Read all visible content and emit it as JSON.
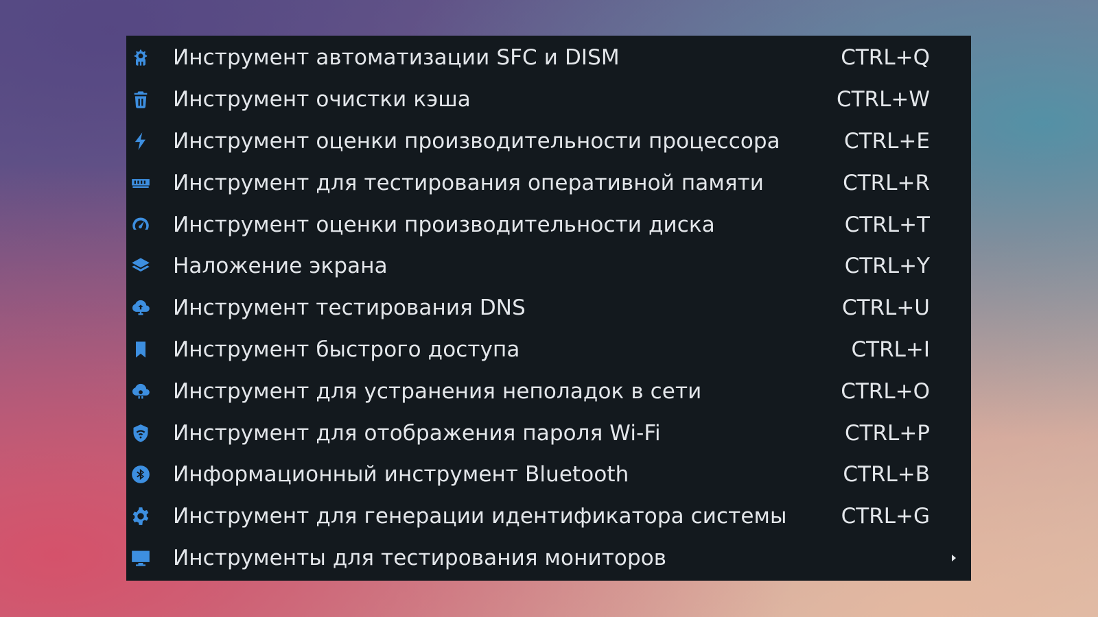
{
  "menu": {
    "items": [
      {
        "label": "Инструмент автоматизации SFC и DISM",
        "shortcut": "CTRL+Q",
        "icon": "tools-gear-icon"
      },
      {
        "label": "Инструмент очистки кэша",
        "shortcut": "CTRL+W",
        "icon": "trash-icon"
      },
      {
        "label": "Инструмент оценки производительности процессора",
        "shortcut": "CTRL+E",
        "icon": "lightning-icon"
      },
      {
        "label": "Инструмент для тестирования оперативной памяти",
        "shortcut": "CTRL+R",
        "icon": "memory-icon"
      },
      {
        "label": "Инструмент оценки производительности диска",
        "shortcut": "CTRL+T",
        "icon": "gauge-icon"
      },
      {
        "label": "Наложение экрана",
        "shortcut": "CTRL+Y",
        "icon": "layers-icon"
      },
      {
        "label": "Инструмент тестирования DNS",
        "shortcut": "CTRL+U",
        "icon": "cloud-network-icon"
      },
      {
        "label": "Инструмент быстрого доступа",
        "shortcut": "CTRL+I",
        "icon": "bookmark-icon"
      },
      {
        "label": "Инструмент для устранения неполадок в сети",
        "shortcut": "CTRL+O",
        "icon": "cloud-gear-icon"
      },
      {
        "label": "Инструмент для отображения пароля Wi-Fi",
        "shortcut": "CTRL+P",
        "icon": "wifi-shield-icon"
      },
      {
        "label": "Информационный инструмент Bluetooth",
        "shortcut": "CTRL+B",
        "icon": "bluetooth-icon"
      },
      {
        "label": "Инструмент для генерации идентификатора системы",
        "shortcut": "CTRL+G",
        "icon": "gear-icon"
      },
      {
        "label": "Инструменты для тестирования мониторов",
        "shortcut": "",
        "icon": "monitor-icon",
        "submenu": true
      }
    ]
  },
  "colors": {
    "menu_background": "#13191e",
    "text": "#e3e6ea",
    "icon_accent": "#3d8fe0"
  }
}
